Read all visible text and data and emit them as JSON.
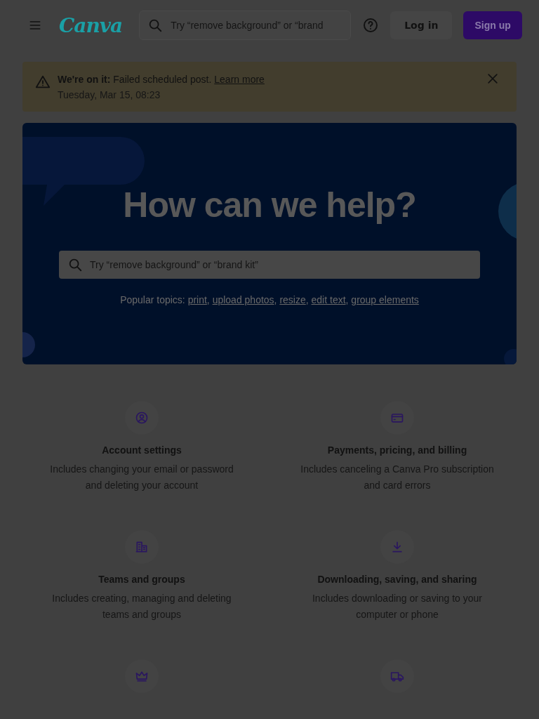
{
  "header": {
    "logo": "Canva",
    "search": {
      "placeholder": "Try “remove background” or “brand"
    },
    "login": "Log in",
    "signup": "Sign up"
  },
  "banner": {
    "lead": "We're on it:",
    "message": "Failed scheduled post.",
    "link": "Learn more",
    "date": "Tuesday, Mar 15, 08:23"
  },
  "hero": {
    "title": "How can we help?",
    "search": {
      "placeholder": "Try “remove background” or “brand kit”"
    },
    "topics_label": "Popular topics:",
    "topics": [
      {
        "label": "print",
        "separator": ","
      },
      {
        "label": "upload photos",
        "separator": ","
      },
      {
        "label": "resize",
        "separator": ","
      },
      {
        "label": "edit text",
        "separator": ","
      },
      {
        "label": "group elements"
      }
    ]
  },
  "categories": [
    {
      "kind": "full",
      "title": "Account settings",
      "description": "Includes changing your email or password and deleting your account"
    },
    {
      "kind": "full",
      "title": "Payments, pricing, and billing",
      "description": "Includes canceling a Canva Pro subscription and card errors"
    },
    {
      "kind": "full",
      "title": "Teams and groups",
      "description": "Includes creating, managing and deleting teams and groups"
    },
    {
      "kind": "full",
      "title": "Downloading, saving, and sharing",
      "description": "Includes downloading or saving to your computer or phone"
    },
    {
      "kind": "cut_off"
    },
    {
      "kind": "cut_off"
    }
  ]
}
